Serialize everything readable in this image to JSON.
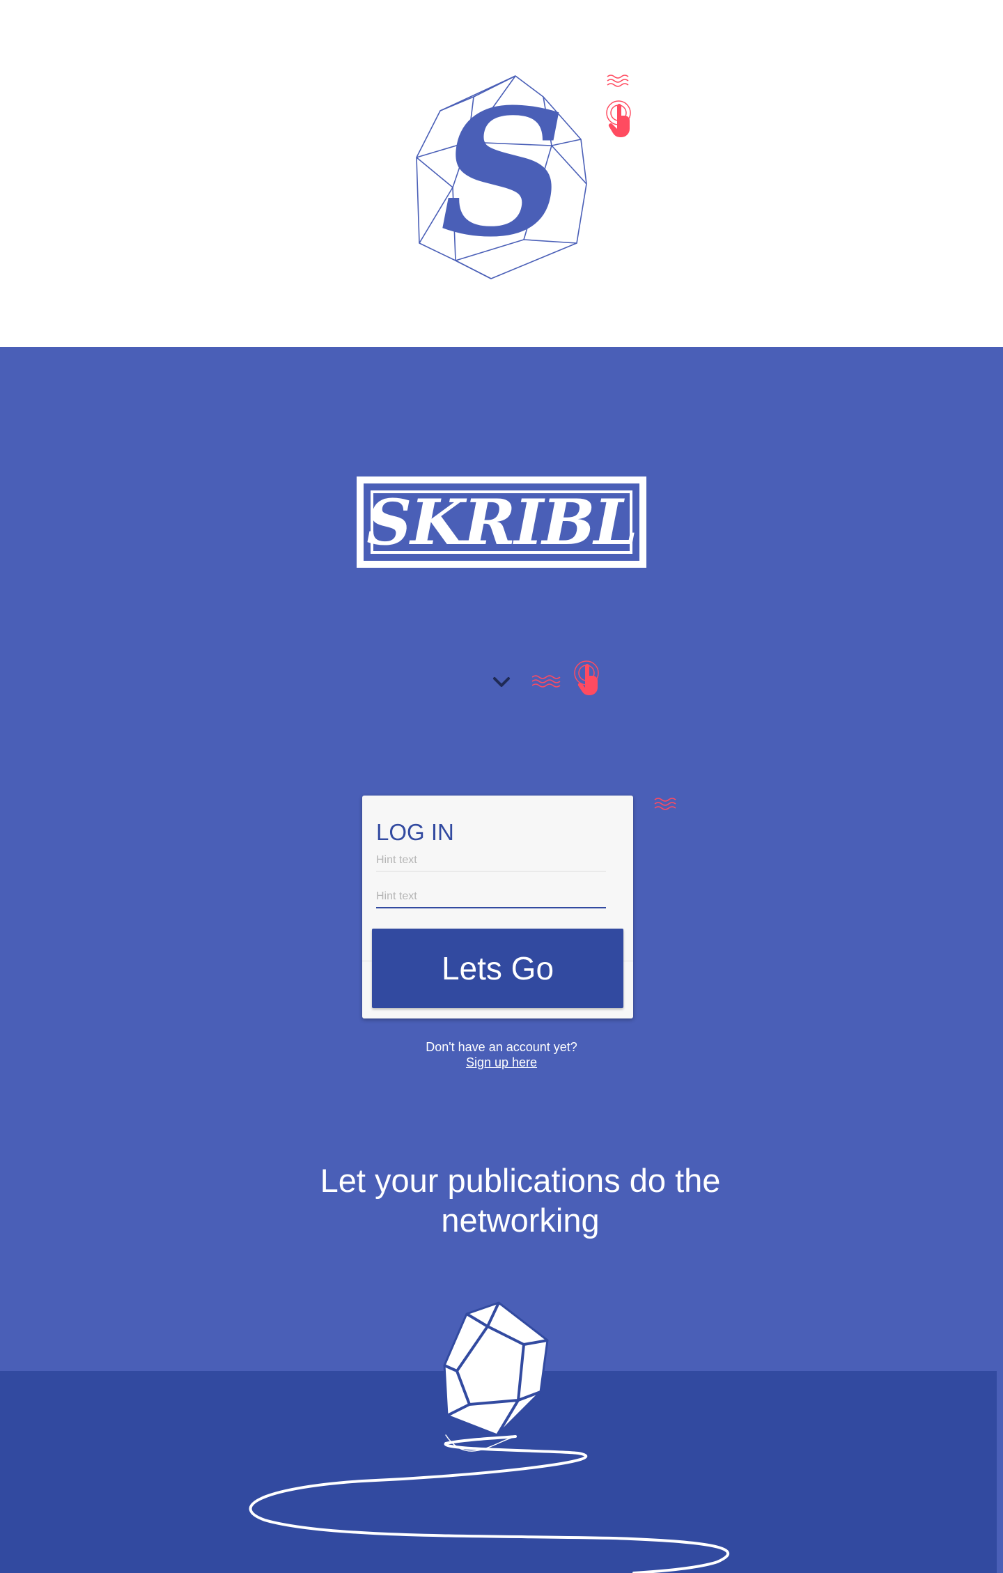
{
  "header": {
    "logo_letter": "S"
  },
  "hero": {
    "brand_name": "SKRIBL"
  },
  "login": {
    "title": "LOG IN",
    "username_placeholder": "Hint text",
    "password_placeholder": "Hint text",
    "submit_label": "Lets Go",
    "signup_prompt": "Don't have an account yet?",
    "signup_link": "Sign up here"
  },
  "tagline": "Let your publications do the networking",
  "icons": [
    "gem-outline-icon",
    "tap-gesture-icon",
    "chevron-down-icon",
    "rock-illustration"
  ],
  "colors": {
    "primary": "#4a5fb7",
    "primary_dark": "#324aa0",
    "accent": "#ff4b60",
    "card_background": "#f7f7f7",
    "text_on_primary": "#ffffff"
  }
}
